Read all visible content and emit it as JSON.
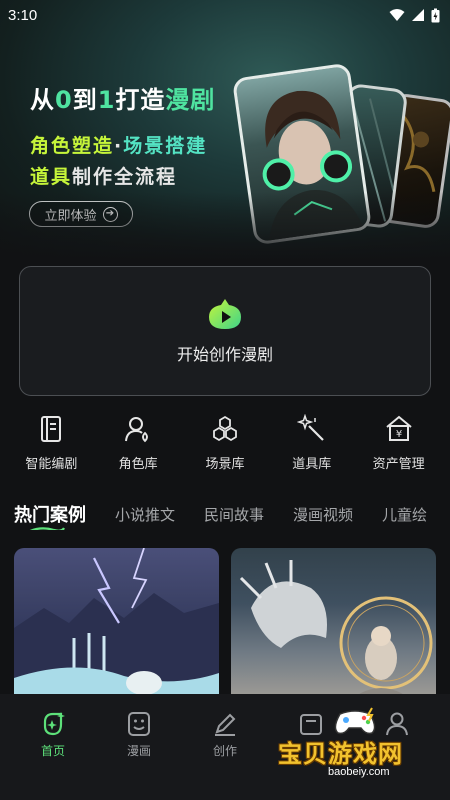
{
  "status_bar": {
    "time": "3:10"
  },
  "banner": {
    "title_a": "从",
    "title_b": "0",
    "title_c": "到",
    "title_d": "1",
    "title_e": "打造",
    "title_f": "漫剧",
    "line1_a": "角色塑造",
    "line1_sep": "·",
    "line1_b": "场景搭建",
    "line2_a": "道具",
    "line2_b": "制作全流程",
    "try_button": "立即体验"
  },
  "create": {
    "label": "开始创作漫剧"
  },
  "tools": [
    {
      "label": "智能编剧",
      "icon": "script-book-icon"
    },
    {
      "label": "角色库",
      "icon": "character-icon"
    },
    {
      "label": "场景库",
      "icon": "hexagons-icon"
    },
    {
      "label": "道具库",
      "icon": "magic-wand-icon"
    },
    {
      "label": "资产管理",
      "icon": "asset-house-icon"
    }
  ],
  "tabs": [
    "热门案例",
    "小说推文",
    "民间故事",
    "漫画视频",
    "儿童绘"
  ],
  "bottom_nav": [
    {
      "label": "首页",
      "icon": "home-sparkle-icon",
      "active": true
    },
    {
      "label": "漫画",
      "icon": "comic-face-icon",
      "active": false
    },
    {
      "label": "创作",
      "icon": "pen-edit-icon",
      "active": false
    },
    {
      "label": "",
      "icon": "box-icon",
      "active": false
    },
    {
      "label": "",
      "icon": "user-icon",
      "active": false
    }
  ],
  "watermark": {
    "name": "宝贝游戏网",
    "url": "baobeiy.com"
  },
  "colors": {
    "accent_green": "#5de07a",
    "accent_lime": "#c6f53a",
    "background": "#111214"
  }
}
